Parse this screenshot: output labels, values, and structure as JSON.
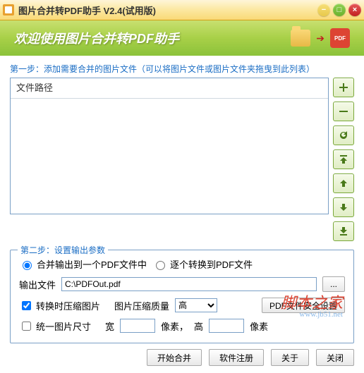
{
  "titlebar": {
    "title": "图片合并转PDF助手  V2.4(试用版)"
  },
  "banner": {
    "welcome": "欢迎使用图片合并转PDF助手",
    "pdf_label": "PDF"
  },
  "step1": {
    "label": "第一步：添加需要合并的图片文件（可以将图片文件或图片文件夹拖曳到此列表）",
    "header": "文件路径",
    "buttons": {
      "add": "add",
      "remove": "remove",
      "refresh": "refresh",
      "top": "top",
      "up": "up",
      "down": "down",
      "bottom": "bottom"
    }
  },
  "step2": {
    "legend": "第二步：设置输出参数",
    "opt_single": "合并输出到一个PDF文件中",
    "opt_multi": "逐个转换到PDF文件",
    "output_label": "输出文件",
    "output_value": "C:\\PDFOut.pdf",
    "browse": "...",
    "compress": "转换时压缩图片",
    "quality_label": "图片压缩质量",
    "quality_value": "高",
    "security_btn": "PDF文件安全设置",
    "unify": "统一图片尺寸",
    "width_label": "宽",
    "height_label": "高",
    "px1": "像素，",
    "px2": "像素"
  },
  "bottom": {
    "start": "开始合并",
    "register": "软件注册",
    "about": "关于",
    "close": "关闭"
  },
  "watermark": {
    "text": "脚本之家",
    "url": "www.jb51.net"
  }
}
